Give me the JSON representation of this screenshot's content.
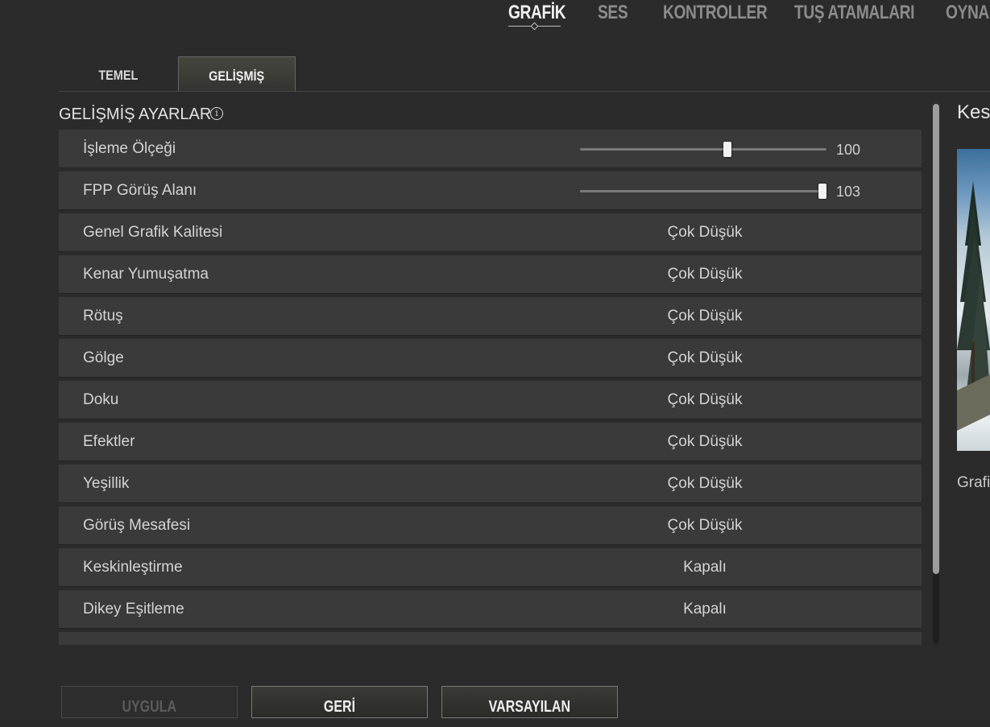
{
  "top_nav": {
    "tabs": [
      {
        "label": "GRAFİK",
        "active": true
      },
      {
        "label": "SES"
      },
      {
        "label": "KONTROLLER"
      },
      {
        "label": "TUŞ ATAMALARI"
      },
      {
        "label": "OYNA"
      }
    ]
  },
  "sub_tabs": [
    {
      "label": "TEMEL"
    },
    {
      "label": "GELİŞMİŞ",
      "active": true
    }
  ],
  "section": {
    "title": "GELİŞMİŞ AYARLAR",
    "info_icon": "info-icon"
  },
  "settings": [
    {
      "label": "İşleme Ölçeği",
      "type": "slider",
      "value": "100",
      "level": 0.6
    },
    {
      "label": "FPP Görüş Alanı",
      "type": "slider",
      "value": "103",
      "level": 1.0
    },
    {
      "label": "Genel Grafik Kalitesi",
      "value": "Çok Düşük"
    },
    {
      "label": "Kenar Yumuşatma",
      "value": "Çok Düşük"
    },
    {
      "label": "Rötuş",
      "value": "Çok Düşük"
    },
    {
      "label": "Gölge",
      "value": "Çok Düşük"
    },
    {
      "label": "Doku",
      "value": "Çok Düşük"
    },
    {
      "label": "Efektler",
      "value": "Çok Düşük"
    },
    {
      "label": "Yeşillik",
      "value": "Çok Düşük"
    },
    {
      "label": "Görüş Mesafesi",
      "value": "Çok Düşük"
    },
    {
      "label": "Keskinleştirme",
      "value": "Kapalı"
    },
    {
      "label": "Dikey Eşitleme",
      "value": "Kapalı"
    }
  ],
  "preview": {
    "title": "Kes",
    "caption": "Grafi"
  },
  "buttons": {
    "apply": "UYGULA",
    "back": "GERİ",
    "default": "VARSAYILAN"
  },
  "colors": {
    "background": "#2b2b2b",
    "row": "#3a3a3a",
    "active_text": "#f2f2f2",
    "inactive_text": "#8c8c8c"
  }
}
